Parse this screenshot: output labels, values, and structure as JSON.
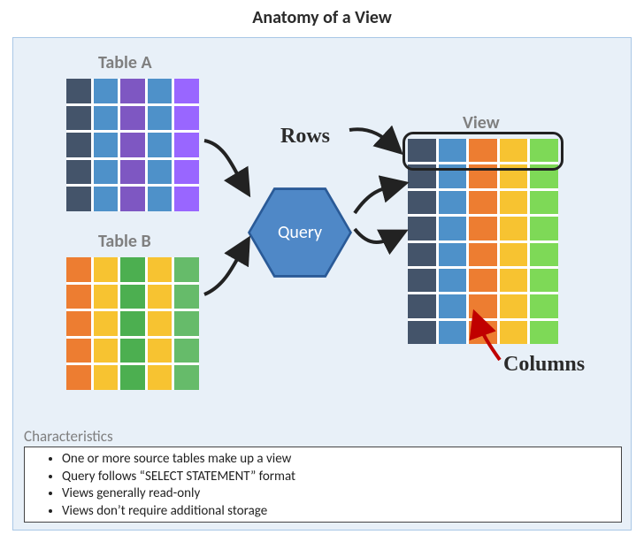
{
  "title": "Anatomy of a View",
  "labels": {
    "tableA": "Table A",
    "tableB": "Table B",
    "view": "View",
    "rows": "Rows",
    "columns": "Columns",
    "query": "Query"
  },
  "characteristics": {
    "heading": "Characteristics",
    "items": [
      "One or more source tables make up a view",
      "Query follows “SELECT STATEMENT” format",
      "Views generally read-only",
      "Views don’t require additional storage"
    ]
  },
  "colors": {
    "panel_bg": "#e8f0f8",
    "panel_border": "#a9c7e6",
    "hex_fill": "#4f88c7",
    "hex_border": "#2a5a97",
    "label_grey": "#7f7f7f",
    "arrow_red": "#c00000"
  },
  "chart_data": {
    "type": "table",
    "tables": {
      "tableA": {
        "rows": 5,
        "cols": 5,
        "column_colors": [
          "darkblue",
          "midblue",
          "purple",
          "midblue",
          "purple2"
        ]
      },
      "tableB": {
        "rows": 5,
        "cols": 5,
        "column_colors": [
          "orange",
          "yellow",
          "green",
          "yellow",
          "green2"
        ]
      },
      "view": {
        "rows": 8,
        "cols": 5,
        "column_colors": [
          "darkblue",
          "midblue",
          "orange",
          "yellow",
          "lime"
        ]
      }
    }
  }
}
